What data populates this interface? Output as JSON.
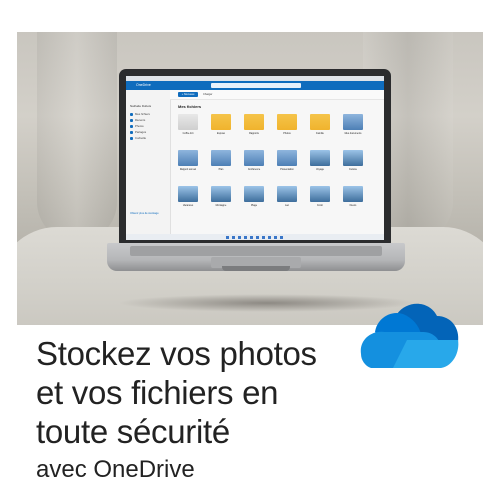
{
  "headline": {
    "line1": "Stockez vos photos",
    "line2": "et vos fichiers en",
    "line3": "toute sécurité"
  },
  "subline": "avec OneDrive",
  "colors": {
    "text": "#222222",
    "cloud_dark": "#0364b8",
    "cloud_mid": "#1490df",
    "cloud_light": "#28a8ea",
    "cloud_top": "#0078d4",
    "folder": "#f0b32d",
    "suitebar": "#0f6cbd"
  },
  "screen": {
    "app_name": "OneDrive",
    "section_title": "Mes fichiers",
    "new_button": "+ Nouveau",
    "upload_button": "Charger",
    "sidebar_user": "Nathalie Dubois",
    "sidebar_items": [
      "Mes fichiers",
      "Récents",
      "Photos",
      "Partagés",
      "Corbeille"
    ],
    "storage_link": "Obtenir plus de stockage",
    "tiles": [
      {
        "name": "Coffre-fort",
        "sub": "",
        "kind": "vault"
      },
      {
        "name": "Exposé",
        "sub": "",
        "kind": "folder"
      },
      {
        "name": "Rapports",
        "sub": "",
        "kind": "folder"
      },
      {
        "name": "Photos",
        "sub": "",
        "kind": "folder"
      },
      {
        "name": "Famille",
        "sub": "",
        "kind": "folder"
      },
      {
        "name": "Mes documents",
        "sub": "",
        "kind": "doc"
      },
      {
        "name": "Rapport annuel",
        "sub": "",
        "kind": "doc"
      },
      {
        "name": "Plan",
        "sub": "",
        "kind": "doc"
      },
      {
        "name": "Conférence",
        "sub": "",
        "kind": "doc"
      },
      {
        "name": "Présentation",
        "sub": "",
        "kind": "doc"
      },
      {
        "name": "Voyage",
        "sub": "",
        "kind": "photo"
      },
      {
        "name": "Cuisine",
        "sub": "",
        "kind": "photo"
      },
      {
        "name": "Vacances",
        "sub": "",
        "kind": "photo"
      },
      {
        "name": "Montagne",
        "sub": "",
        "kind": "photo"
      },
      {
        "name": "Plage",
        "sub": "",
        "kind": "photo"
      },
      {
        "name": "Lac",
        "sub": "",
        "kind": "photo"
      },
      {
        "name": "Forêt",
        "sub": "",
        "kind": "photo"
      },
      {
        "name": "Fleurs",
        "sub": "",
        "kind": "photo"
      }
    ]
  }
}
